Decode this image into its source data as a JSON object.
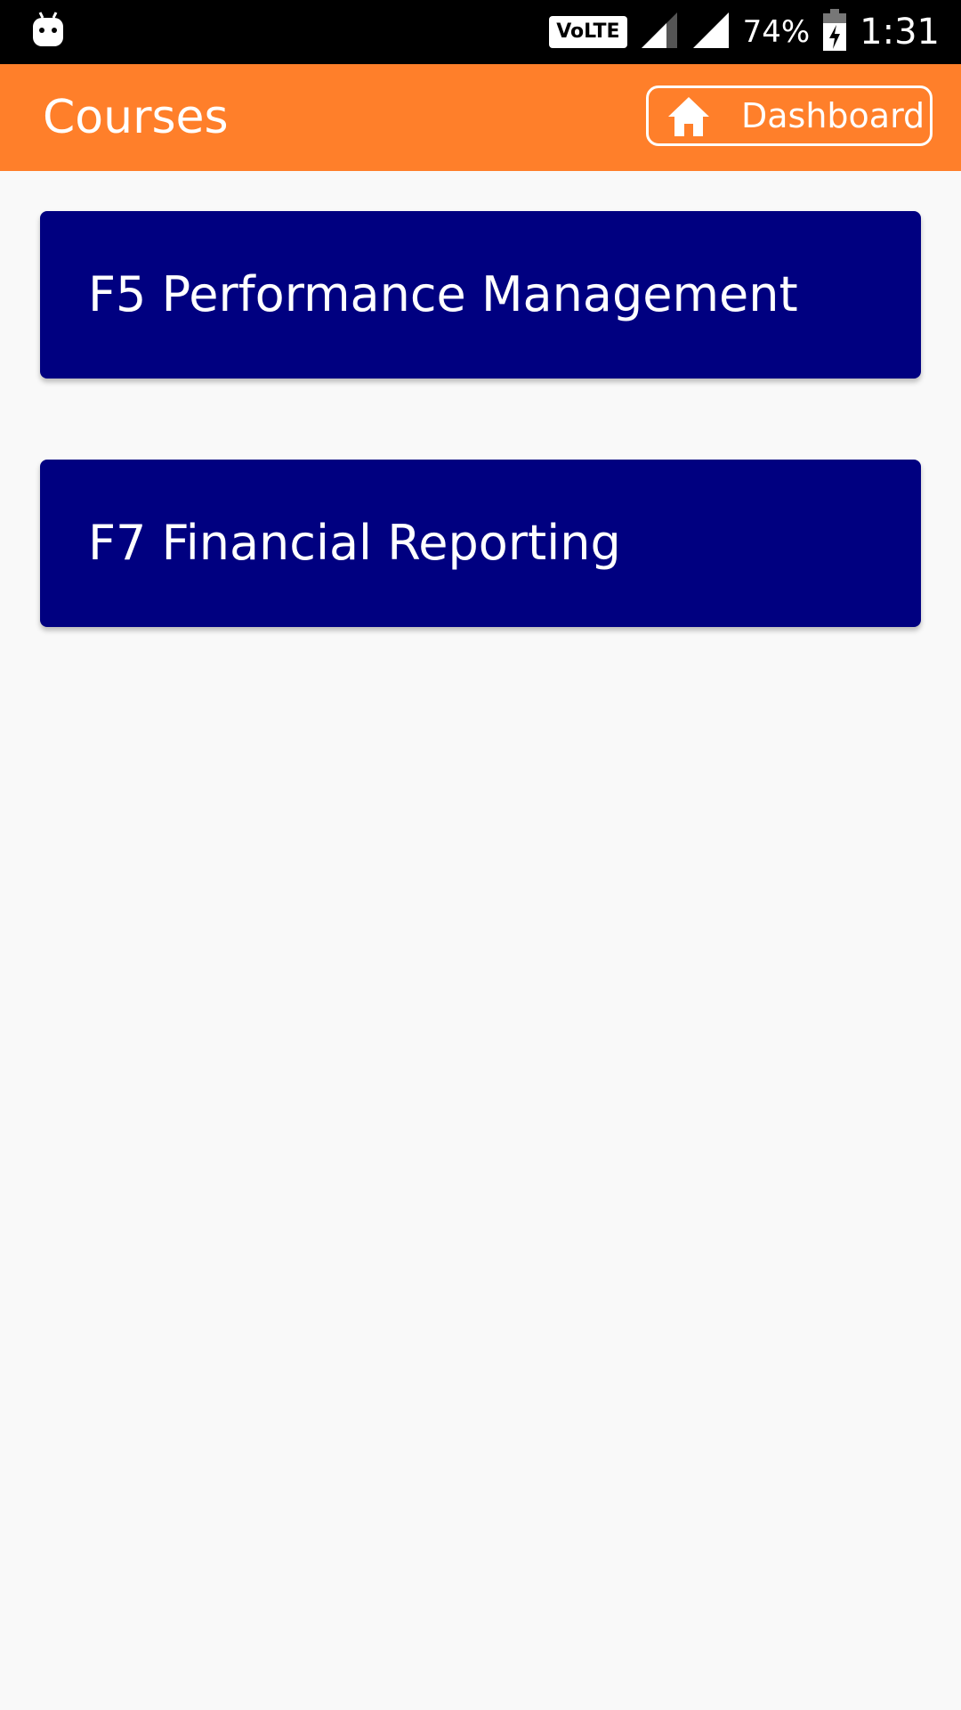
{
  "status_bar": {
    "notification_icon": "android-icon",
    "volte": "VoLTE",
    "signal_icon_1": "signal-icon",
    "signal_icon_2": "signal-icon",
    "battery_percent": "74%",
    "battery_icon": "battery-charging-icon",
    "time": "1:31"
  },
  "toolbar": {
    "title": "Courses",
    "dashboard_button": {
      "icon": "home-icon",
      "label": "Dashboard"
    },
    "color": "#ff7f2a"
  },
  "courses": [
    {
      "label": "F5 Performance Management"
    },
    {
      "label": "F7 Financial Reporting"
    }
  ],
  "colors": {
    "card_background": "#000080",
    "page_background": "#f9f9f9",
    "status_bar": "#000000"
  }
}
